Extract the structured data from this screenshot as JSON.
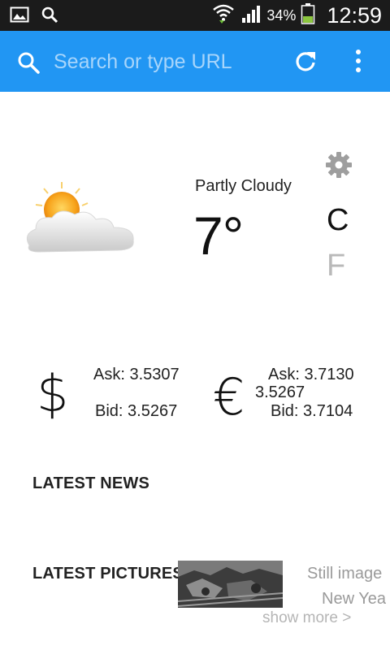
{
  "status_bar": {
    "battery_percent": "34%",
    "time": "12:59",
    "icons": [
      "gallery-icon",
      "search-icon",
      "wifi-icon",
      "signal-icon",
      "battery-icon"
    ]
  },
  "toolbar": {
    "search_placeholder": "Search or type URL",
    "icons": [
      "search-icon",
      "refresh-icon",
      "more-vert-icon"
    ],
    "background_color": "#2196f3"
  },
  "weather": {
    "condition": "Partly Cloudy",
    "temperature": "7°",
    "unit_celsius": "C",
    "unit_fahrenheit": "F",
    "selected_unit": "C",
    "icon": "partly-cloudy-icon"
  },
  "currencies": {
    "usd": {
      "symbol": "$",
      "ask": "Ask: 3.5307",
      "bid": "Bid: 3.5267"
    },
    "eur": {
      "symbol": "€",
      "ask": "Ask: 3.7130",
      "mid": "3.5267",
      "bid": "Bid: 3.7104"
    }
  },
  "sections": {
    "latest_news": "LATEST NEWS",
    "latest_pictures": "LATEST PICTURES"
  },
  "pictures": {
    "caption_line1": "Still image",
    "caption_line2": "New Yea",
    "show_more": "show more >"
  }
}
